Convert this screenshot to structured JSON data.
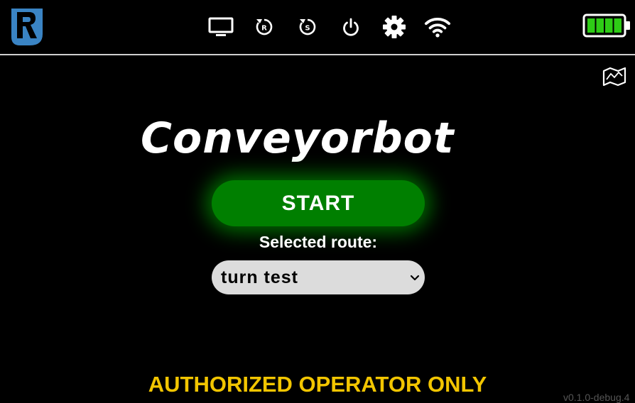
{
  "brand": {
    "name": "Conveyorbot",
    "logo_icon": "robot-r-logo"
  },
  "topbar": {
    "icons": [
      {
        "name": "monitor-icon",
        "label": ""
      },
      {
        "name": "reset-r-icon",
        "label": "R"
      },
      {
        "name": "reset-s-icon",
        "label": "S"
      },
      {
        "name": "power-icon",
        "label": ""
      },
      {
        "name": "gear-icon",
        "label": ""
      },
      {
        "name": "wifi-icon",
        "label": ""
      }
    ],
    "battery": {
      "level": 1.0,
      "color": "#2ecc16"
    }
  },
  "map_button_icon": "map-icon",
  "main": {
    "start_label": "START",
    "route_label": "Selected route:",
    "route_value": "turn test"
  },
  "footer": {
    "warning": "AUTHORIZED OPERATOR ONLY",
    "version": "v0.1.0-debug.4"
  },
  "colors": {
    "start_button": "#007f00",
    "warning": "#f2c500",
    "logo": "#3a84c4"
  }
}
